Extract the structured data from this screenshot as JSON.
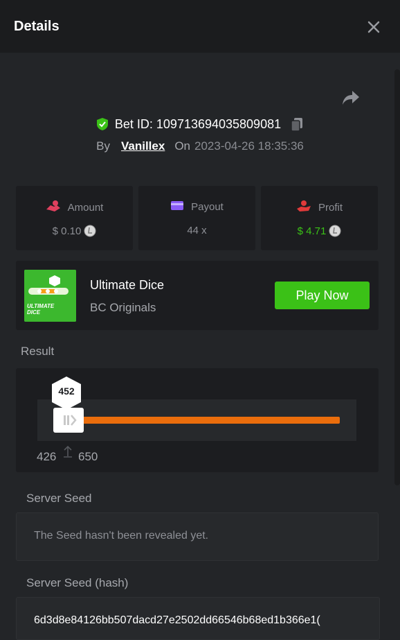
{
  "header": {
    "title": "Details"
  },
  "bet": {
    "id_label": "Bet ID: 109713694035809081",
    "by_label": "By",
    "user": "Vanillex",
    "on_label": "On",
    "date": "2023-04-26 18:35:36"
  },
  "stats": {
    "amount": {
      "label": "Amount",
      "value": "$ 0.10"
    },
    "payout": {
      "label": "Payout",
      "value": "44 x"
    },
    "profit": {
      "label": "Profit",
      "value": "$ 4.71"
    }
  },
  "game": {
    "name": "Ultimate Dice",
    "provider": "BC Originals",
    "play_label": "Play Now",
    "thumb_text_line1": "ULTIMATE",
    "thumb_text_line2": "DICE"
  },
  "result": {
    "label": "Result",
    "roll": "452",
    "range_low": "426",
    "range_high": "650"
  },
  "server_seed": {
    "label": "Server Seed",
    "value": "The Seed hasn't been revealed yet."
  },
  "server_seed_hash": {
    "label": "Server Seed (hash)",
    "value": "6d3d8e84126bb507dacd27e2502dd66546b68ed1b366e1("
  },
  "colors": {
    "accent_green": "#3bc117",
    "result_bar": "#ea6d0c",
    "amount_icon": "#e0405e",
    "payout_icon": "#8a5cf6",
    "profit_icon": "#e03a3a"
  },
  "icons": {
    "close": "close-icon",
    "share": "share-icon",
    "shield": "shield-check-icon",
    "copy": "copy-icon",
    "amount": "bet-hand-icon",
    "payout": "wallet-icon",
    "profit": "profit-hand-icon",
    "coin": "coin-icon"
  }
}
